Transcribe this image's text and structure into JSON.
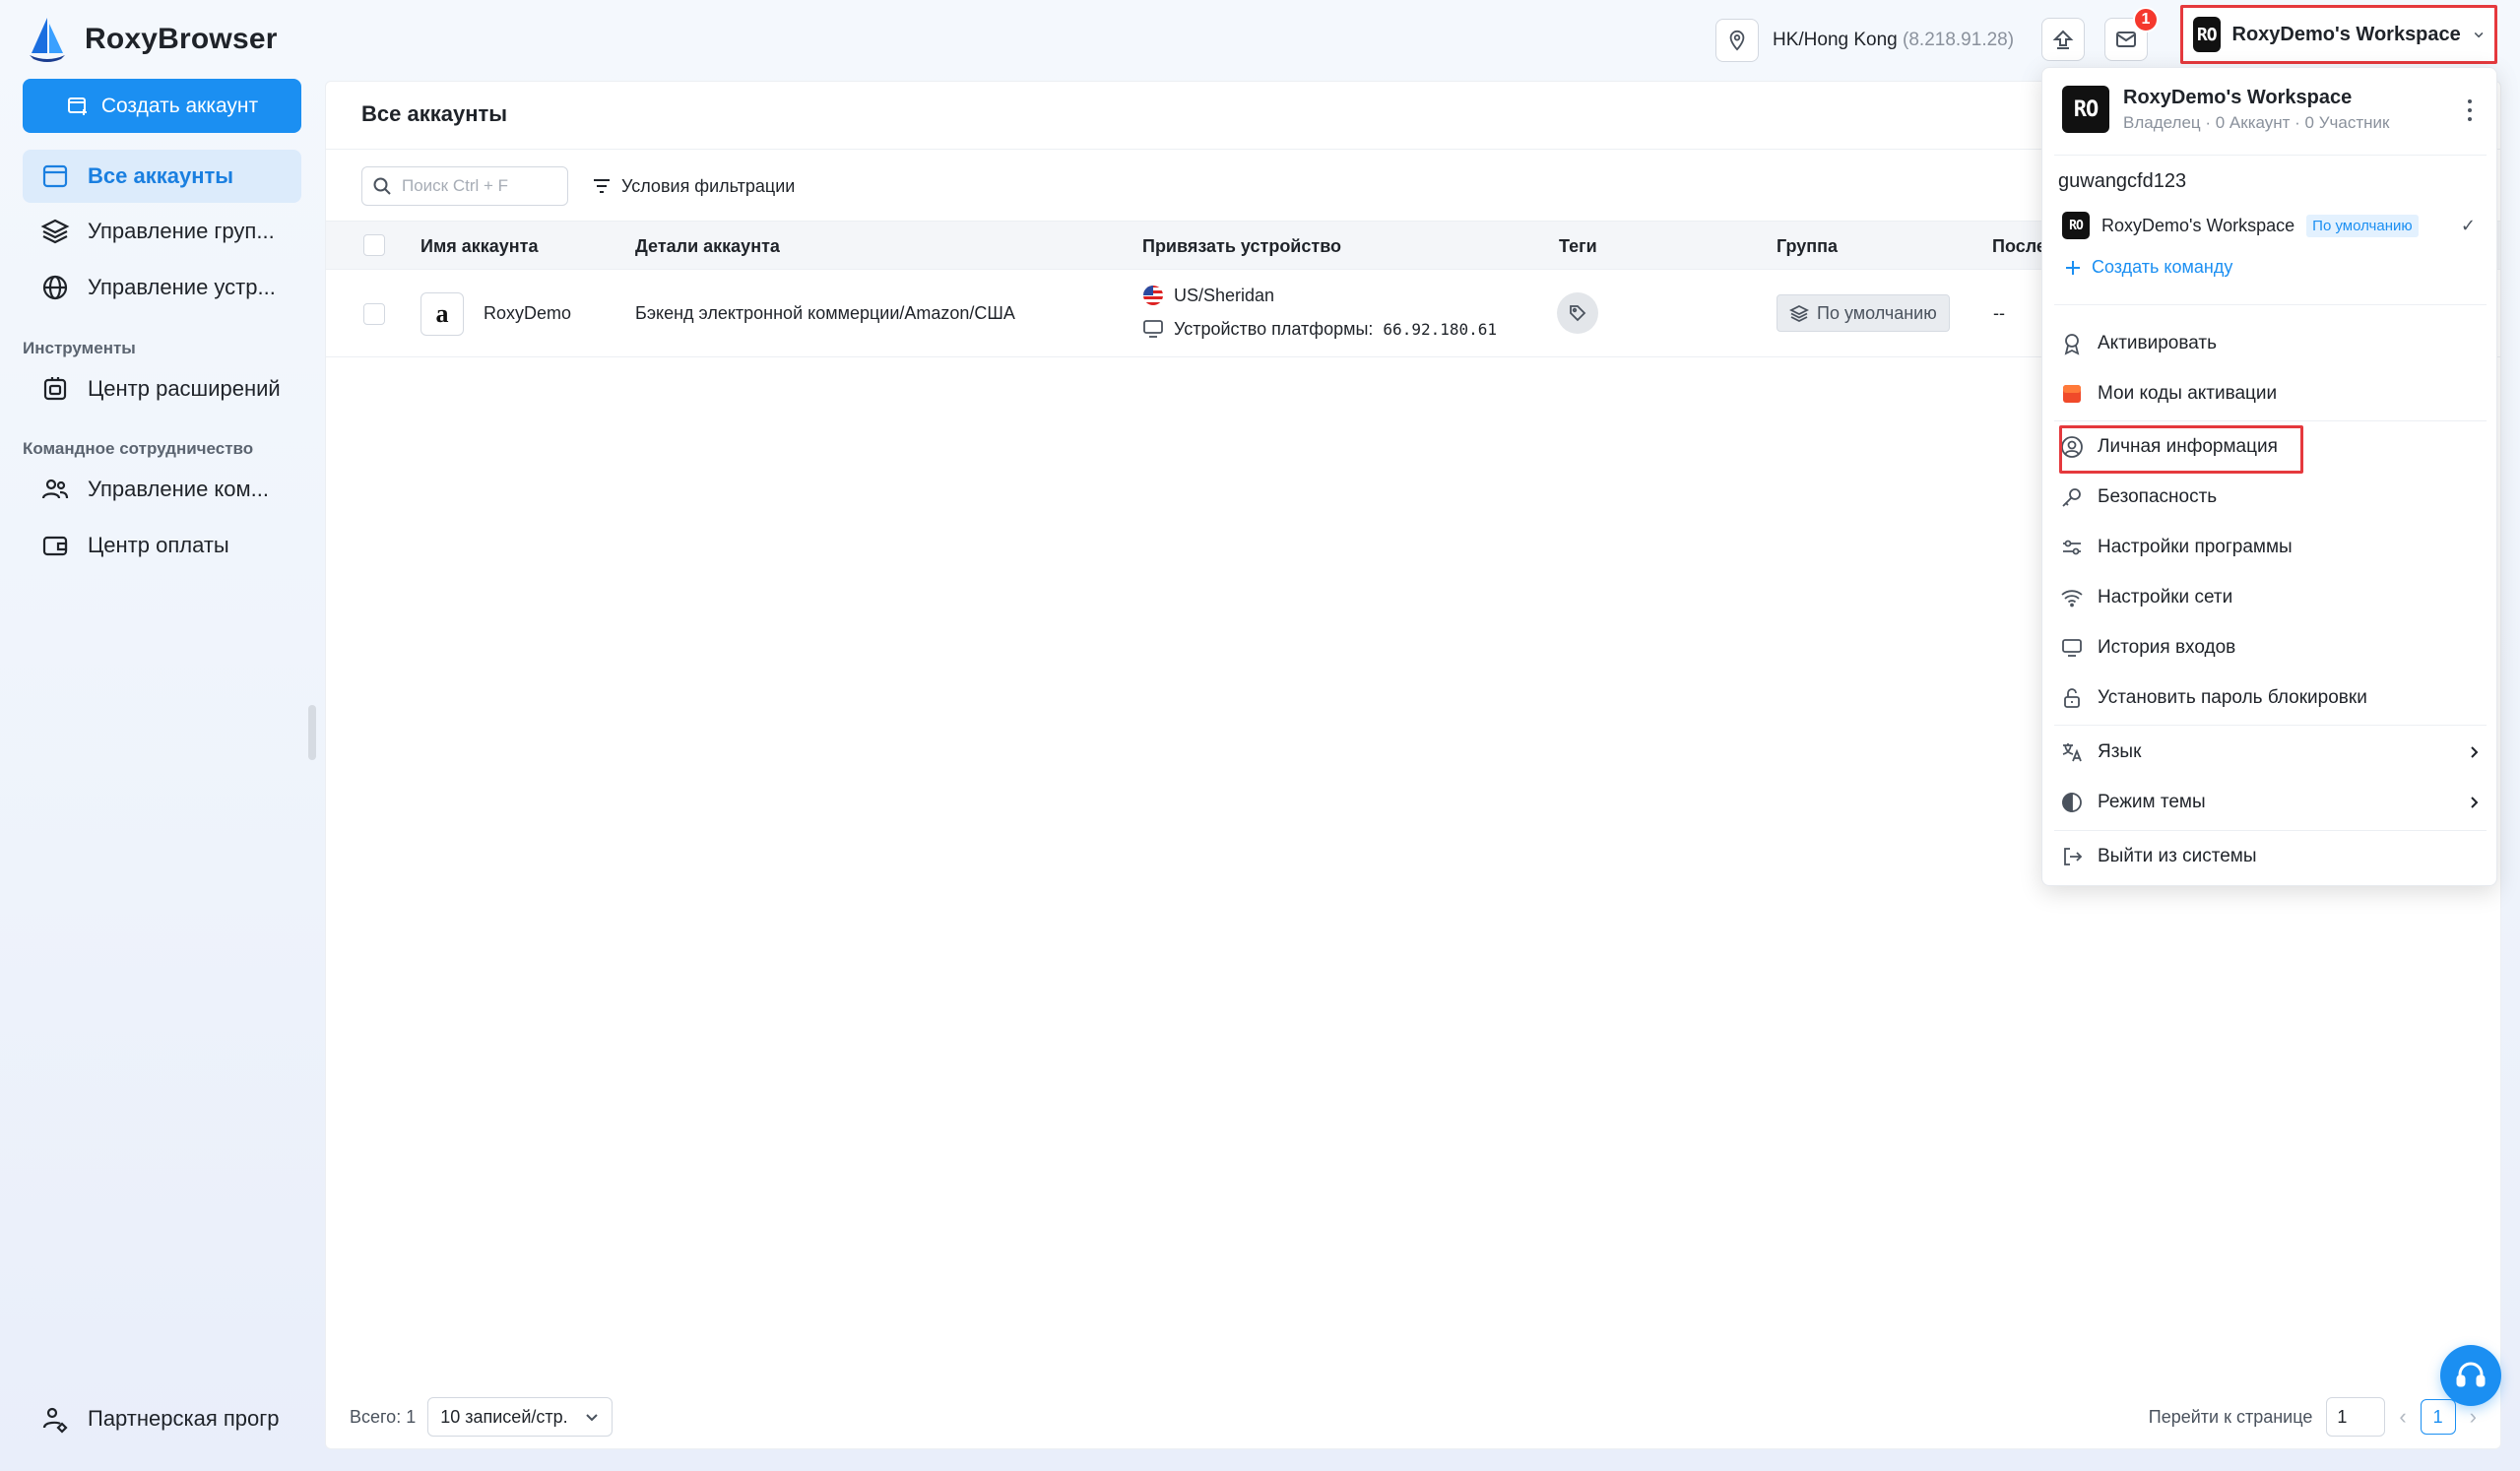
{
  "app": {
    "name": "RoxyBrowser"
  },
  "topbar": {
    "location": "HK/Hong Kong",
    "ip": "(8.218.91.28)",
    "notification_count": "1",
    "workspace_avatar": "RO",
    "workspace_name": "RoxyDemo's Workspace"
  },
  "sidebar": {
    "create_button": "Создать аккаунт",
    "items": [
      {
        "label": "Все аккаунты",
        "icon": "browser-window-icon"
      },
      {
        "label": "Управление груп...",
        "icon": "layers-icon"
      },
      {
        "label": "Управление устр...",
        "icon": "globe-icon"
      }
    ],
    "section_tools": "Инструменты",
    "tools_items": [
      {
        "label": "Центр расширений",
        "icon": "extension-icon"
      }
    ],
    "section_team": "Командное сотрудничество",
    "team_items": [
      {
        "label": "Управление ком...",
        "icon": "team-icon"
      },
      {
        "label": "Центр оплаты",
        "icon": "wallet-icon"
      }
    ],
    "partner": "Партнерская прогр"
  },
  "main": {
    "title": "Все аккаунты",
    "search_placeholder": "Поиск Ctrl + F",
    "filter_label": "Условия фильтрации",
    "columns": [
      "Имя аккаунта",
      "Детали аккаунта",
      "Привязать устройство",
      "Теги",
      "Группа",
      "После"
    ],
    "rows": [
      {
        "name": "RoxyDemo",
        "platform_icon": "a",
        "details": "Бэкенд электронной коммерции/Amazon/США",
        "device_location": "US/Sheridan",
        "device_label": "Устройство платформы:",
        "device_ip": "66.92.180.61",
        "group": "По умолчанию",
        "last": "--"
      }
    ],
    "footer": {
      "total_label": "Всего: 1",
      "page_size": "10 записей/стр.",
      "goto_label": "Перейти к странице",
      "goto_value": "1",
      "current_page": "1"
    }
  },
  "menu": {
    "ws_avatar": "RO",
    "ws_name": "RoxyDemo's Workspace",
    "ws_sub": "Владелец · 0 Аккаунт · 0 Участник",
    "username": "guwangcfd123",
    "team_avatar": "RO",
    "team_name": "RoxyDemo's Workspace",
    "team_default": "По умолчанию",
    "create_team": "Создать команду",
    "items": [
      {
        "label": "Активировать",
        "icon": "award-icon"
      },
      {
        "label": "Мои коды активации",
        "icon": "activation-code-icon"
      },
      {
        "label": "Личная информация",
        "icon": "user-circle-icon"
      },
      {
        "label": "Безопасность",
        "icon": "key-icon"
      },
      {
        "label": "Настройки программы",
        "icon": "settings-sliders-icon"
      },
      {
        "label": "Настройки сети",
        "icon": "wifi-icon"
      },
      {
        "label": "История входов",
        "icon": "monitor-icon"
      },
      {
        "label": "Установить пароль блокировки",
        "icon": "lock-icon"
      },
      {
        "label": "Язык",
        "icon": "translate-icon"
      },
      {
        "label": "Режим темы",
        "icon": "theme-icon"
      },
      {
        "label": "Выйти из системы",
        "icon": "logout-icon"
      }
    ]
  },
  "colors": {
    "accent": "#1b8ff2",
    "highlight": "#e5393d",
    "badge": "#f5382d"
  }
}
